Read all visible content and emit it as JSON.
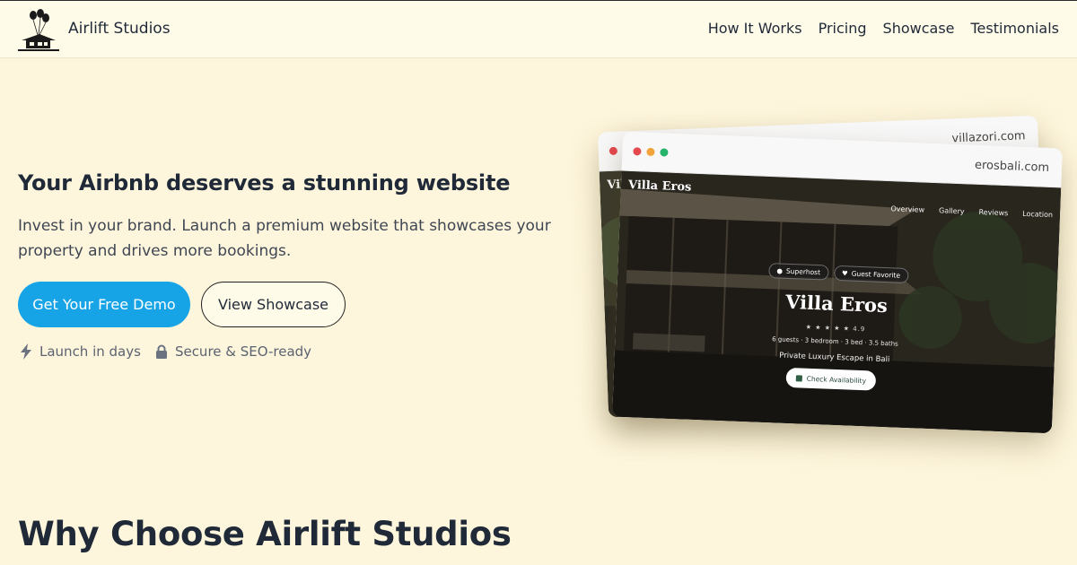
{
  "header": {
    "brand": "Airlift Studios",
    "nav": [
      "How It Works",
      "Pricing",
      "Showcase",
      "Testimonials"
    ]
  },
  "hero": {
    "title": "Your Airbnb deserves a stunning website",
    "subtitle": "Invest in your brand. Launch a premium website that showcases your property and drives more bookings.",
    "primary_button": "Get Your Free Demo",
    "secondary_button": "View Showcase",
    "features": [
      {
        "icon": "lightning-icon",
        "label": "Launch in days"
      },
      {
        "icon": "lock-icon",
        "label": "Secure & SEO-ready"
      }
    ]
  },
  "mockups": {
    "back": {
      "url": "villazori.com",
      "site_logo": "Villa Zori"
    },
    "front": {
      "url": "erosbali.com",
      "site_logo": "Villa Eros",
      "nav": [
        "Overview",
        "Gallery",
        "Reviews",
        "Location"
      ],
      "badges": [
        "Superhost",
        "Guest Favorite"
      ],
      "title": "Villa Eros",
      "rating": "★ ★ ★ ★ ★  4.9",
      "details": "6 guests · 3 bedroom · 3 bed · 3.5 baths",
      "tagline": "Private Luxury Escape in Bali",
      "cta": "Check Availability"
    },
    "dot_colors": [
      "#e5484d",
      "#f2a33a",
      "#27b36b"
    ]
  },
  "section": {
    "title": "Why Choose Airlift Studios"
  },
  "colors": {
    "background": "#fef6dc",
    "accent": "#17a4e6"
  }
}
